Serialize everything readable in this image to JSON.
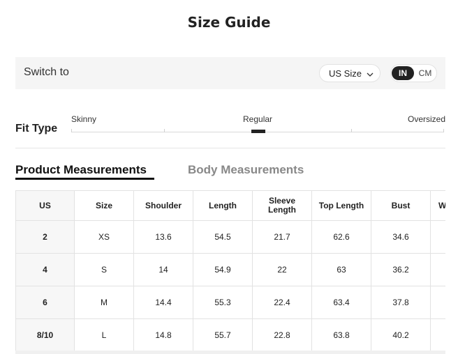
{
  "title": "Size Guide",
  "switch": {
    "label": "Switch to",
    "size_system": "US Size",
    "unit_in": "IN",
    "unit_cm": "CM",
    "selected_unit": "IN"
  },
  "fit": {
    "label": "Fit Type",
    "options": [
      "Skinny",
      "Regular",
      "Oversized"
    ],
    "selected": "Regular"
  },
  "tabs": {
    "product": "Product Measurements",
    "body": "Body Measurements",
    "active": "Product Measurements"
  },
  "table": {
    "headers": [
      "US",
      "Size",
      "Shoulder",
      "Length",
      "Sleeve Length",
      "Top Length",
      "Bust",
      "W"
    ],
    "rows": [
      [
        "2",
        "XS",
        "13.6",
        "54.5",
        "21.7",
        "62.6",
        "34.6",
        ""
      ],
      [
        "4",
        "S",
        "14",
        "54.9",
        "22",
        "63",
        "36.2",
        ""
      ],
      [
        "6",
        "M",
        "14.4",
        "55.3",
        "22.4",
        "63.4",
        "37.8",
        ""
      ],
      [
        "8/10",
        "L",
        "14.8",
        "55.7",
        "22.8",
        "63.8",
        "40.2",
        ""
      ]
    ]
  },
  "colors": {
    "accent": "#222222",
    "bar_bg": "#f5f5f5",
    "inactive_tab": "#888888"
  }
}
